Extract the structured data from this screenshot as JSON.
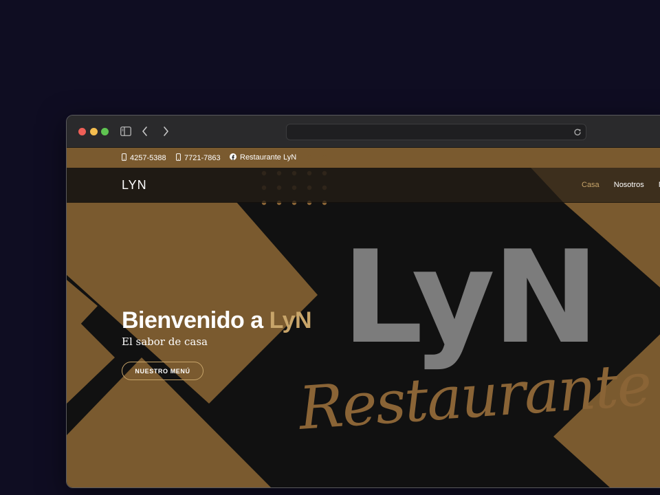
{
  "colors": {
    "page_background": "#0f0d22",
    "gold": "#7a5a2f",
    "accent": "#c8a56a",
    "hero_dark": "#111111",
    "logo_gray": "#7c7c7c"
  },
  "browser": {
    "url": "",
    "icons": [
      "sidebar-icon",
      "chevron-left-icon",
      "chevron-right-icon",
      "reload-icon"
    ]
  },
  "topbar": {
    "phone1": "4257-5388",
    "phone2": "7721-7863",
    "facebook": "Restaurante LyN"
  },
  "navbar": {
    "brand": "LYN",
    "links": [
      "Casa",
      "Nosotros",
      "M"
    ],
    "active": "Casa"
  },
  "hero": {
    "title_prefix": "Bienvenido a ",
    "title_accent": "LyN",
    "subtitle": "El sabor de casa",
    "cta_label": "NUESTRO MENÚ",
    "logo_text": "LyN",
    "logo_script": "Restaurante"
  }
}
